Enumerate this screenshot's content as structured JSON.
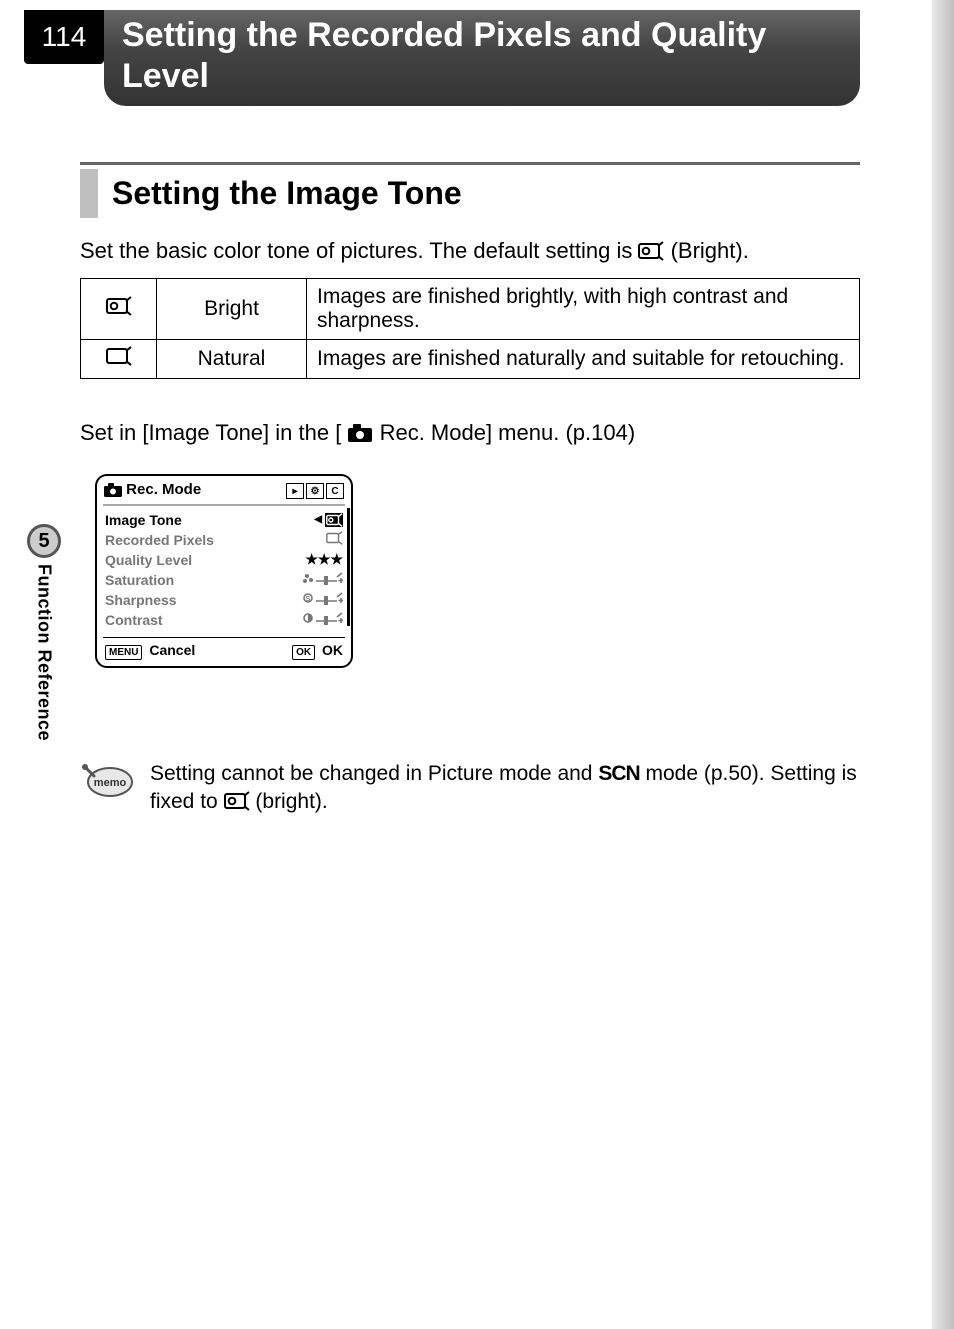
{
  "page_number": "114",
  "title": "Setting the Recorded Pixels and Quality Level",
  "section_heading": "Setting the Image Tone",
  "intro_before_icon": "Set the basic color tone of pictures. The default setting is ",
  "intro_after_icon": " (Bright).",
  "tone_table": {
    "rows": [
      {
        "label": "Bright",
        "desc": "Images are finished brightly, with high contrast and sharpness."
      },
      {
        "label": "Natural",
        "desc": "Images are finished naturally and suitable for retouching."
      }
    ]
  },
  "setin_before_icon": "Set in [Image Tone] in the [",
  "setin_after_icon": " Rec. Mode] menu. (p.104)",
  "menu": {
    "header": "Rec. Mode",
    "items": [
      {
        "label": "Image Tone",
        "value_icon": "bright",
        "selected": true
      },
      {
        "label": "Recorded Pixels",
        "value_icon": "natural"
      },
      {
        "label": "Quality Level",
        "value_text": "★★★"
      },
      {
        "label": "Saturation",
        "value_icon": "slider-sat"
      },
      {
        "label": "Sharpness",
        "value_icon": "slider-sharp"
      },
      {
        "label": "Contrast",
        "value_icon": "slider-contrast"
      }
    ],
    "footer_left_key": "MENU",
    "footer_left": "Cancel",
    "footer_right_key": "OK",
    "footer_right": "OK"
  },
  "memo_before1": "Setting cannot be changed in Picture mode and ",
  "memo_scn": "SCN",
  "memo_after1": " mode (p.50). Setting is fixed to ",
  "memo_after2": " (bright).",
  "side_tab": {
    "number": "5",
    "label": "Function Reference"
  }
}
